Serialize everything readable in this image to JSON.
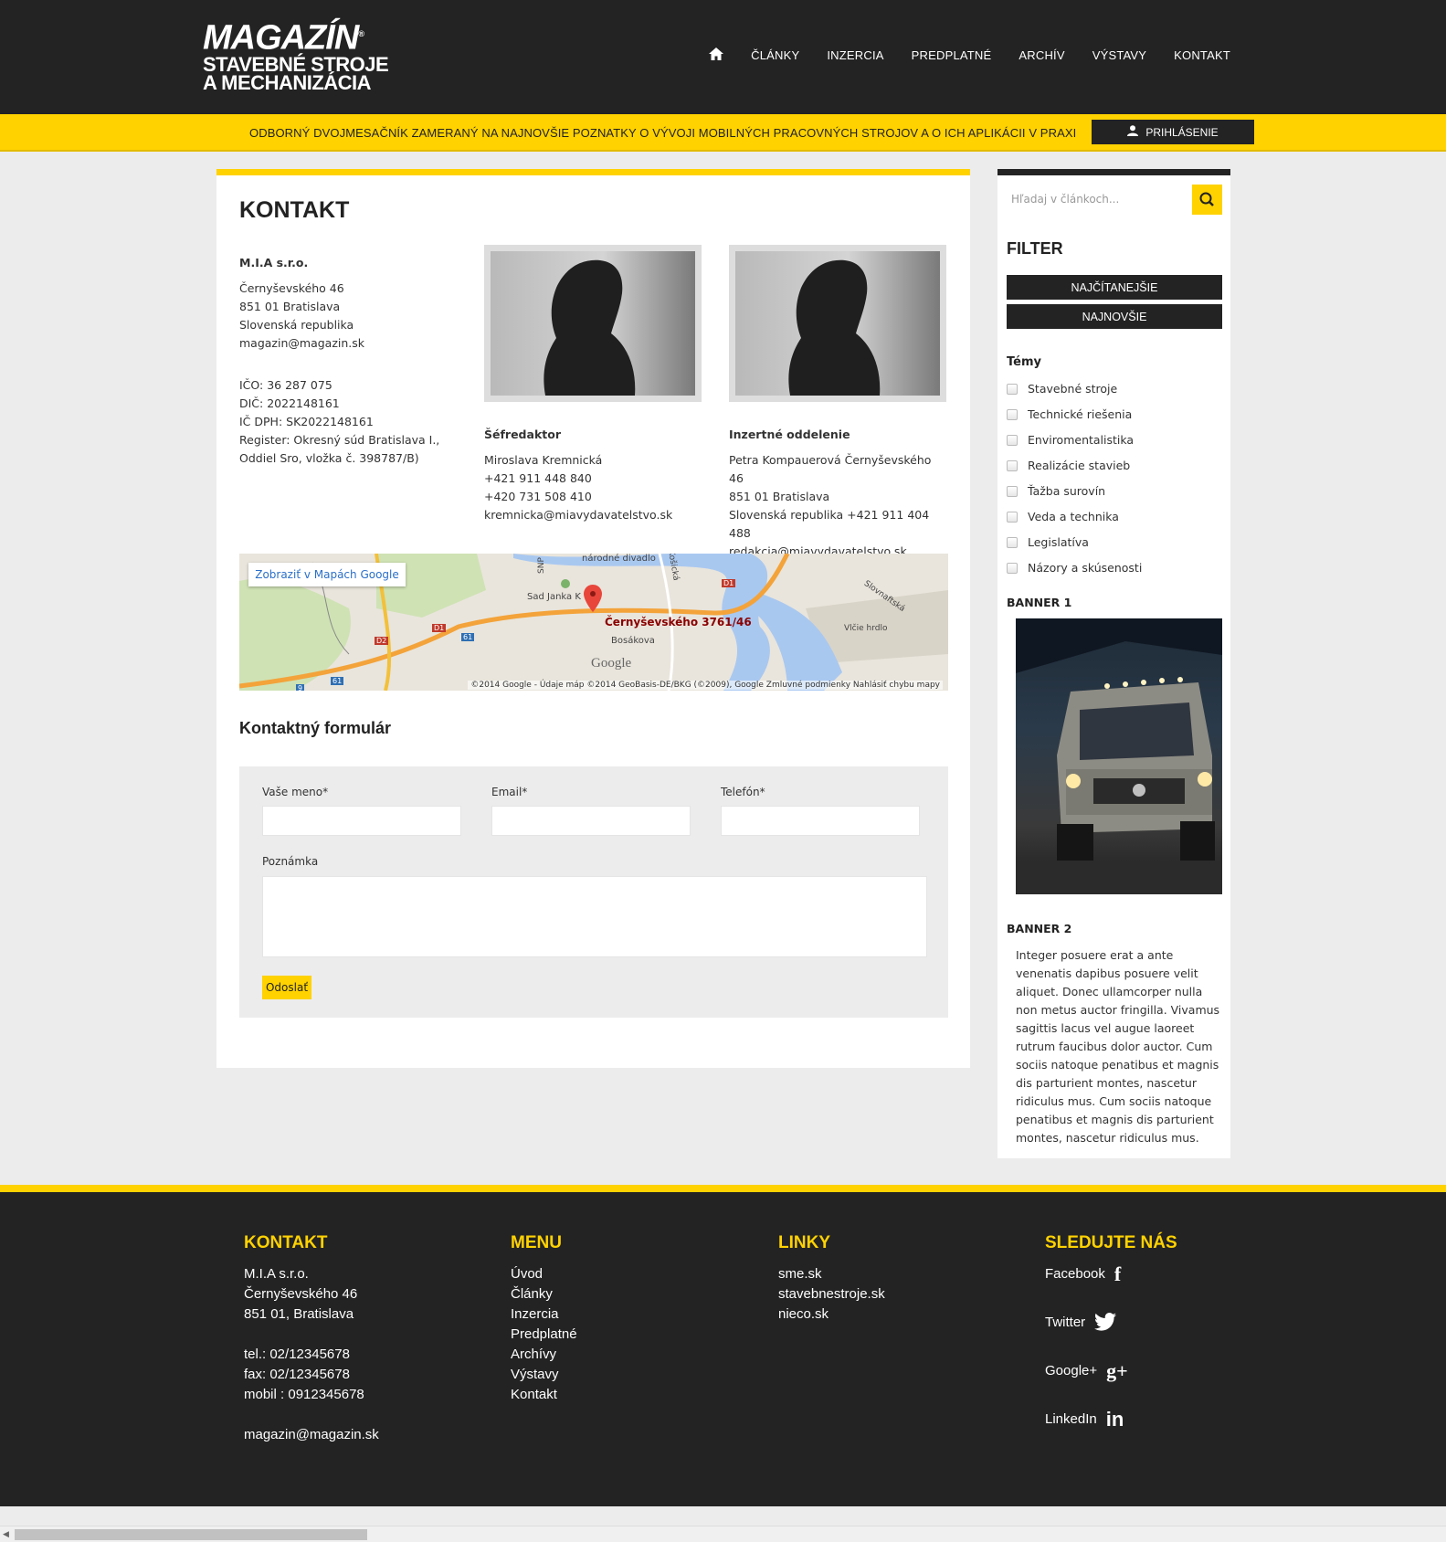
{
  "logo": {
    "line1": "MAGAZÍN",
    "reg": "®",
    "line2": "STAVEBNÉ STROJE",
    "line3": "A MECHANIZÁCIA"
  },
  "nav": {
    "home_icon": "home-icon",
    "items": [
      "ČLÁNKY",
      "INZERCIA",
      "PREDPLATNÉ",
      "ARCHÍV",
      "VÝSTAVY",
      "KONTAKT"
    ]
  },
  "slogan": "ODBORNÝ DVOJMESAČNÍK ZAMERANÝ NA NAJNOVŠIE POZNATKY O VÝVOJI MOBILNÝCH PRACOVNÝCH STROJOV A O ICH APLIKÁCII V PRAXI",
  "login": {
    "label": "PRIHLÁSENIE",
    "icon": "user-icon"
  },
  "page": {
    "title": "KONTAKT"
  },
  "company": {
    "name": "M.I.A s.r.o.",
    "address": [
      "Černyševského 46",
      "851 01 Bratislava",
      "Slovenská republika",
      "magazin@magazin.sk"
    ],
    "ids": [
      "IČO: 36 287 075",
      "DIČ: 2022148161",
      "IČ DPH: SK2022148161",
      "Register: Okresný súd Bratislava I.,",
      "Oddiel Sro, vložka č. 398787/B)"
    ]
  },
  "persons": [
    {
      "role": "Šéfredaktor",
      "lines": [
        "Miroslava Kremnická",
        "+421 911 448 840",
        "+420 731 508 410",
        "kremnicka@miavydavatelstvo.sk"
      ]
    },
    {
      "role": "Inzertné oddelenie",
      "lines": [
        "Petra Kompauerová Černyševského 46",
        "851 01 Bratislava",
        "Slovenská republika +421 911 404 488",
        "redakcia@miavydavatelstvo.sk"
      ]
    }
  ],
  "map": {
    "button": "Zobraziť v Mapách Google",
    "pin_label": "Černyševského 3761/46",
    "watermark": "Google",
    "footer": "©2014 Google - Údaje máp ©2014 GeoBasis-DE/BKG (©2009), Google   Zmluvné podmienky   Nahlásiť chybu mapy",
    "places": [
      "národné divadlo",
      "Sad Janka K",
      "Bosákova",
      "Slovnaftská",
      "Vlčie hrdlo",
      "Košická",
      "SNP",
      "D1",
      "D2",
      "61",
      "9"
    ]
  },
  "form": {
    "title": "Kontaktný formulár",
    "name_label": "Vaše meno*",
    "email_label": "Email*",
    "phone_label": "Telefón*",
    "note_label": "Poznámka",
    "submit": "Odoslať"
  },
  "sidebar": {
    "search_placeholder": "Hľadaj v článkoch...",
    "filter_title": "FILTER",
    "filter_buttons": [
      "NAJČÍTANEJŠIE",
      "NAJNOVŠIE"
    ],
    "themes_title": "Témy",
    "themes": [
      "Stavebné stroje",
      "Technické riešenia",
      "Enviromentalistika",
      "Realizácie stavieb",
      "Ťažba surovín",
      "Veda a technika",
      "Legislatíva",
      "Názory a skúsenosti"
    ],
    "banner1_title": "BANNER 1",
    "banner2_title": "BANNER 2",
    "banner2_text": "Integer posuere erat a ante venenatis dapibus posuere velit aliquet. Donec ullamcorper nulla non metus auctor fringilla. Vivamus sagittis lacus vel augue laoreet rutrum faucibus dolor auctor. Cum sociis natoque penatibus et magnis dis parturient montes, nascetur ridiculus mus. Cum sociis natoque penatibus et magnis dis parturient montes, nascetur ridiculus mus."
  },
  "footer": {
    "contact": {
      "title": "KONTAKT",
      "lines1": [
        "M.I.A s.r.o.",
        "Černyševského 46",
        "851 01, Bratislava"
      ],
      "lines2": [
        "tel.: 02/12345678",
        "fax: 02/12345678",
        "mobil : 0912345678"
      ],
      "email": "magazin@magazin.sk"
    },
    "menu": {
      "title": "MENU",
      "items": [
        "Úvod",
        "Články",
        "Inzercia",
        "Predplatné",
        "Archívy",
        "Výstavy",
        "Kontakt"
      ]
    },
    "links": {
      "title": "LINKY",
      "items": [
        "sme.sk",
        "stavebnestroje.sk",
        "nieco.sk"
      ]
    },
    "follow": {
      "title": "SLEDUJTE NÁS",
      "items": [
        {
          "label": "Facebook",
          "icon": "facebook-icon",
          "glyph": "f"
        },
        {
          "label": "Twitter",
          "icon": "twitter-icon",
          "glyph": ""
        },
        {
          "label": "Google+",
          "icon": "google-plus-icon",
          "glyph": "g+"
        },
        {
          "label": "LinkedIn",
          "icon": "linkedin-icon",
          "glyph": "in"
        }
      ]
    }
  },
  "colors": {
    "accent": "#ffd200",
    "dark": "#232323",
    "background": "#ececec"
  }
}
